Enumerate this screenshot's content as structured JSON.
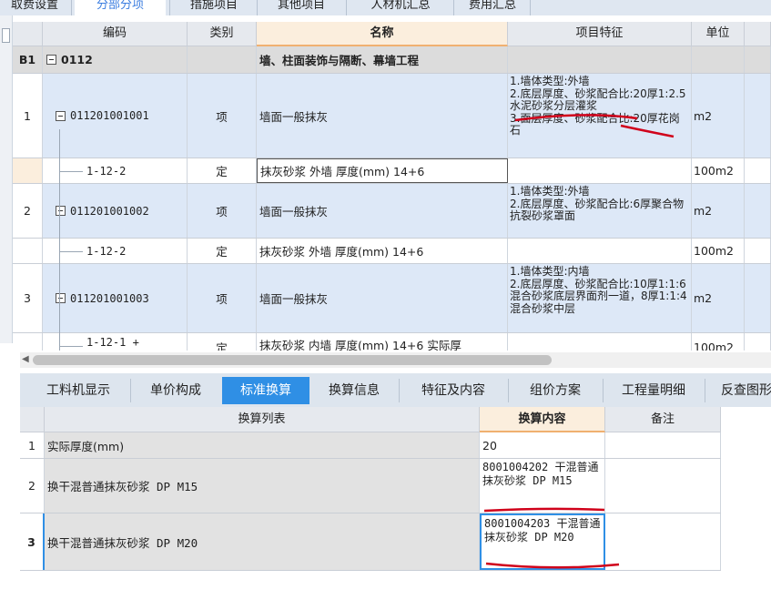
{
  "top_tabs": [
    "取费设置",
    "分部分项",
    "措施项目",
    "其他项目",
    "人材机汇总",
    "费用汇总"
  ],
  "top_tabs_active": 1,
  "grid": {
    "headers": [
      "编码",
      "类别",
      "名称",
      "项目特征",
      "单位"
    ],
    "selected_header": "名称",
    "section": {
      "index": "B1",
      "code": "0112",
      "name": "墙、柱面装饰与隔断、幕墙工程"
    },
    "rows": [
      {
        "index": "1",
        "code": "011201001001",
        "type": "项",
        "name": "墙面一般抹灰",
        "feature": "1.墙体类型:外墙\n2.底层厚度、砂浆配合比:20厚1:2.5水泥砂浆分层灌浆\n3.面层厚度、砂浆配合比:20厚花岗石",
        "unit": "m2"
      },
      {
        "index": "",
        "code": "1-12-2",
        "type": "定",
        "name": "抹灰砂浆 外墙 厚度(mm) 14+6",
        "feature": "",
        "unit": "100m2"
      },
      {
        "index": "2",
        "code": "011201001002",
        "type": "项",
        "name": "墙面一般抹灰",
        "feature": "1.墙体类型:外墙\n2.底层厚度、砂浆配合比:6厚聚合物抗裂砂浆罩面",
        "unit": "m2"
      },
      {
        "index": "",
        "code": "1-12-2",
        "type": "定",
        "name": "抹灰砂浆 外墙 厚度(mm) 14+6",
        "feature": "",
        "unit": "100m2"
      },
      {
        "index": "3",
        "code": "011201001003",
        "type": "项",
        "name": "墙面一般抹灰",
        "feature": "1.墙体类型:内墙\n2.底层厚度、砂浆配合比:10厚1:1:6混合砂浆底层界面剂一道，8厚1:1:4混合砂浆中层",
        "unit": "m2"
      },
      {
        "index": "",
        "code": "1-12-1 +",
        "type": "定",
        "name": "抹灰砂浆 内墙 厚度(mm) 14+6  实际厚",
        "feature": "",
        "unit": "100m2"
      }
    ]
  },
  "bottom_tabs": [
    "工料机显示",
    "单价构成",
    "标准换算",
    "换算信息",
    "特征及内容",
    "组价方案",
    "工程量明细",
    "反查图形"
  ],
  "bottom_tabs_active": 2,
  "bottom_grid": {
    "headers": [
      "换算列表",
      "换算内容",
      "备注"
    ],
    "rows": [
      {
        "index": "1",
        "list": "实际厚度(mm)",
        "content": "20",
        "note": ""
      },
      {
        "index": "2",
        "list": "换干混普通抹灰砂浆 DP M15",
        "content": "8001004202  干混普通抹灰砂浆 DP M15",
        "note": ""
      },
      {
        "index": "3",
        "list": "换干混普通抹灰砂浆 DP M20",
        "content": "8001004203  干混普通抹灰砂浆 DP M20",
        "note": ""
      }
    ]
  },
  "colors": {
    "accent": "#2f8fe5",
    "annotation": "#d0021b",
    "row_blue": "#dde8f7",
    "section_gray": "#dcdcdc"
  }
}
